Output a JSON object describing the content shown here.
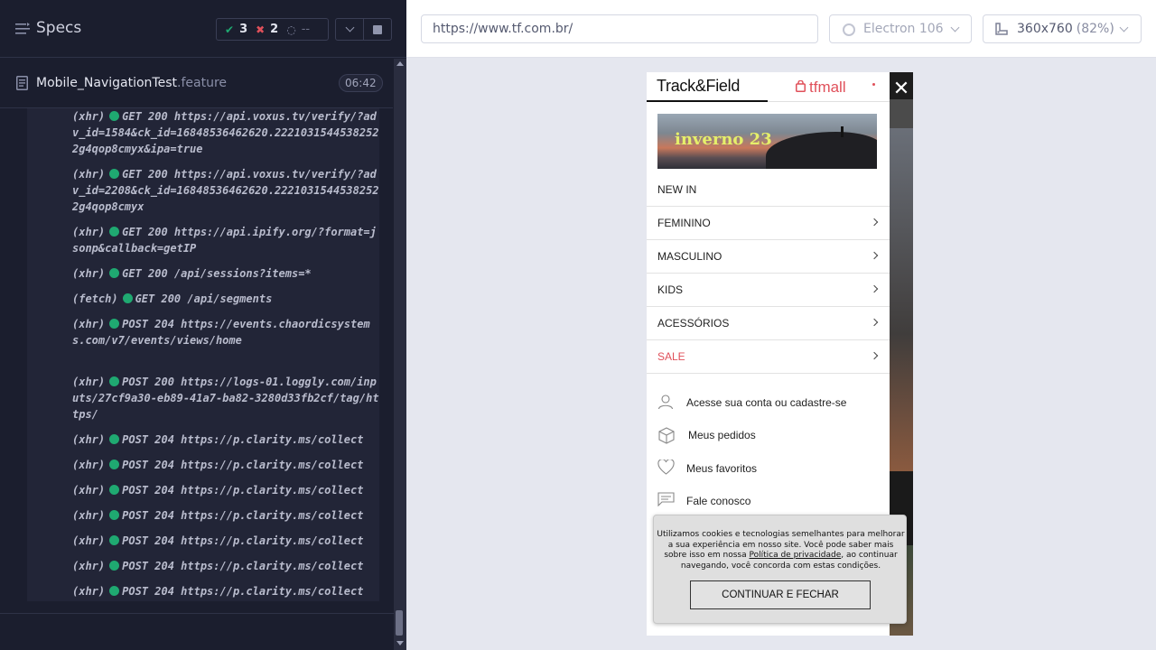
{
  "runner": {
    "title": "Specs",
    "stats": {
      "passed": "3",
      "failed": "2",
      "pending": "--"
    },
    "spec": {
      "name": "Mobile_NavigationTest",
      "ext": ".feature",
      "duration": "06:42"
    },
    "log": [
      {
        "type": "(xhr)",
        "text": "GET 200 https://api.voxus.tv/verify/?adv_id=1584&ck_id=16848536462620.22210315445382522g4qop8cmyx&ipa=true"
      },
      {
        "type": "(xhr)",
        "text": "GET 200 https://api.voxus.tv/verify/?adv_id=2208&ck_id=16848536462620.22210315445382522g4qop8cmyx"
      },
      {
        "type": "(xhr)",
        "text": "GET 200 https://api.ipify.org/?format=jsonp&callback=getIP"
      },
      {
        "type": "(xhr)",
        "text": "GET 200 /api/sessions?items=*"
      },
      {
        "type": "(fetch)",
        "text": "GET 200 /api/segments"
      },
      {
        "type": "(xhr)",
        "text": "POST 204 https://events.chaordicsystems.com/v7/events/views/home"
      },
      {
        "type": "(xhr)",
        "text": "POST 200 https://logs-01.loggly.com/inputs/27cf9a30-eb89-41a7-ba82-3280d33fb2cf/tag/https/"
      },
      {
        "type": "(xhr)",
        "text": "POST 204 https://p.clarity.ms/collect"
      },
      {
        "type": "(xhr)",
        "text": "POST 204 https://p.clarity.ms/collect"
      },
      {
        "type": "(xhr)",
        "text": "POST 204 https://p.clarity.ms/collect"
      },
      {
        "type": "(xhr)",
        "text": "POST 204 https://p.clarity.ms/collect"
      },
      {
        "type": "(xhr)",
        "text": "POST 204 https://p.clarity.ms/collect"
      },
      {
        "type": "(xhr)",
        "text": "POST 204 https://p.clarity.ms/collect"
      },
      {
        "type": "(xhr)",
        "text": "POST 204 https://p.clarity.ms/collect"
      }
    ]
  },
  "toolbar": {
    "url": "https://www.tf.com.br/",
    "browser": "Electron 106",
    "viewport": "360x760",
    "scale": "(82%)"
  },
  "app": {
    "tab_brand": "Track&Field",
    "tab_mall": "tfmall",
    "banner_text": "inverno 23",
    "menu": [
      {
        "label": "NEW IN",
        "has_arrow": false
      },
      {
        "label": "FEMININO",
        "has_arrow": true
      },
      {
        "label": "MASCULINO",
        "has_arrow": true
      },
      {
        "label": "KIDS",
        "has_arrow": true
      },
      {
        "label": "ACESSÓRIOS",
        "has_arrow": true
      },
      {
        "label": "SALE",
        "has_arrow": true
      }
    ],
    "account": [
      {
        "label": "Acesse sua conta ou cadastre-se",
        "icon": "user-icon"
      },
      {
        "label": "Meus pedidos",
        "icon": "box-icon"
      },
      {
        "label": "Meus favoritos",
        "icon": "heart-icon"
      },
      {
        "label": "Fale conosco",
        "icon": "chat-icon"
      }
    ],
    "cookie": {
      "text_before": "Utilizamos cookies e tecnologias semelhantes para melhorar a sua experiência em nosso site. Você pode saber mais sobre isso em nossa ",
      "link": "Política de privacidade",
      "text_after": ", ao continuar navegando, você concorda com estas condições.",
      "button": "CONTINUAR E FECHAR"
    }
  },
  "colors": {
    "pass": "#1fa971",
    "fail": "#e0505a",
    "sale": "#e0505a"
  }
}
